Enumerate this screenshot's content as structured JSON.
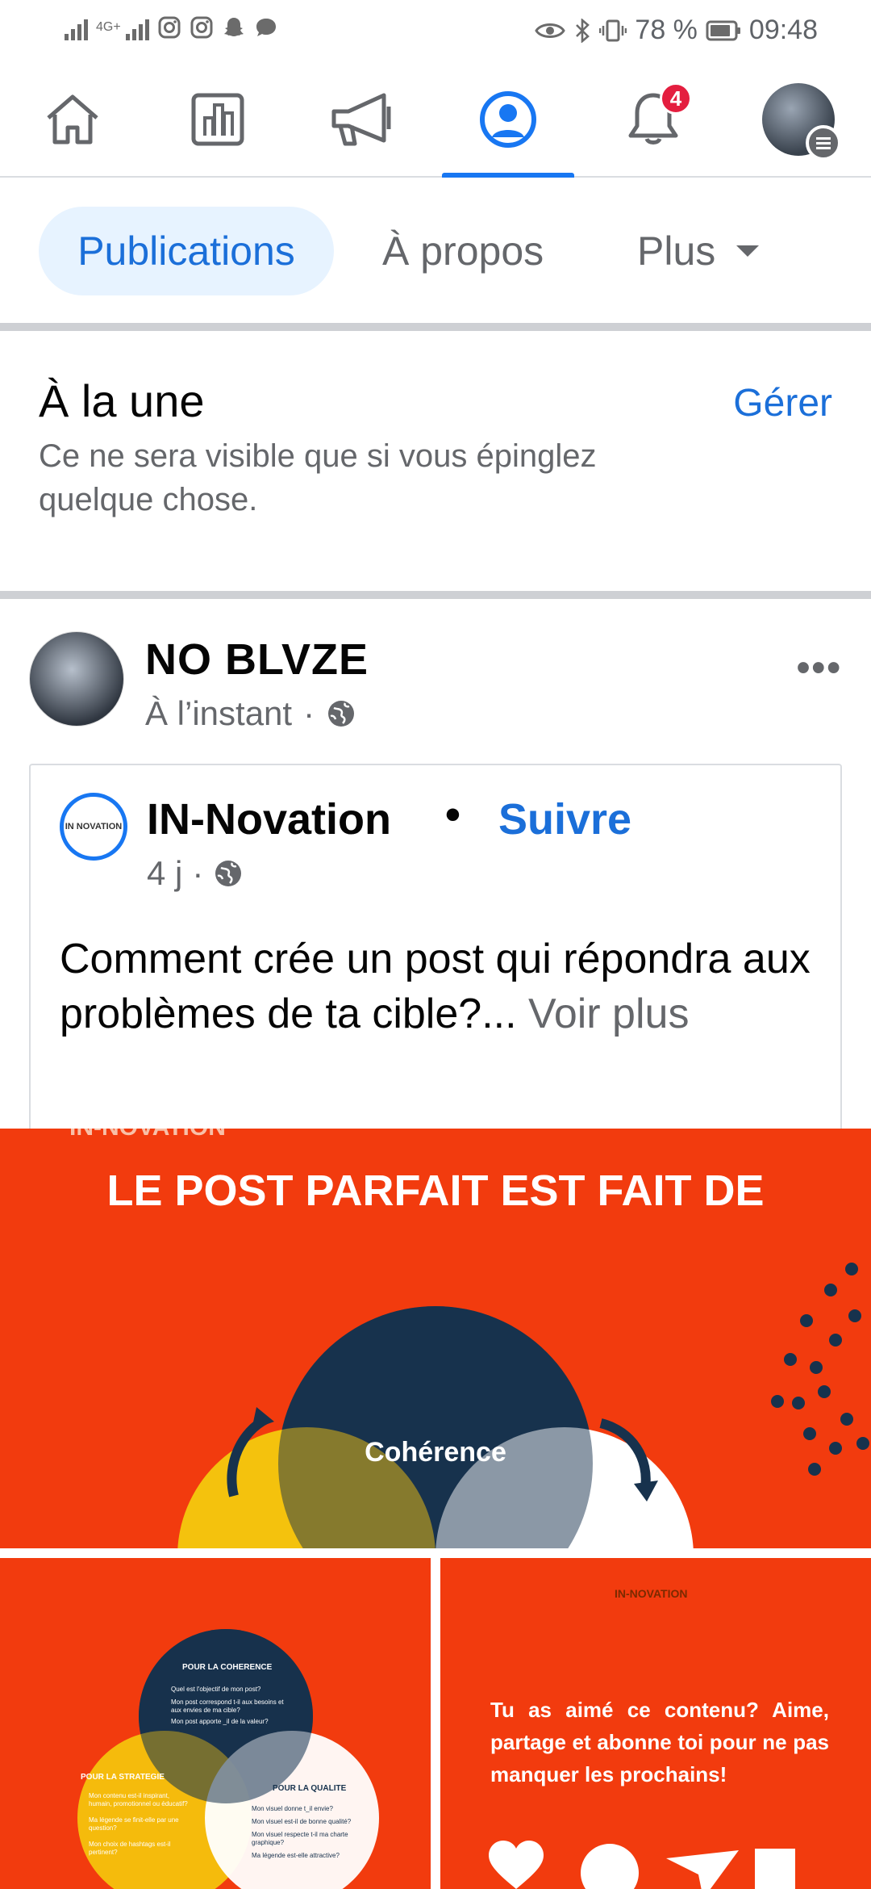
{
  "status_bar": {
    "network": "4G+",
    "battery": "78 %",
    "time": "09:48",
    "left_icons": [
      "signal-icon",
      "signal-icon",
      "instagram-icon",
      "instagram-icon",
      "snapchat-icon",
      "chat-icon"
    ],
    "right_icons": [
      "eye-icon",
      "bluetooth-icon",
      "vibrate-icon",
      "battery-icon"
    ]
  },
  "topnav": {
    "items": [
      "home-icon",
      "pages-icon",
      "ads-icon",
      "profile-icon",
      "bell-icon",
      "account-avatar"
    ],
    "active": "profile-icon",
    "notification_count": "4",
    "accent": "#1877f2"
  },
  "tabs": {
    "publications": "Publications",
    "about": "À propos",
    "more": "Plus"
  },
  "featured": {
    "title": "À la une",
    "manage": "Gérer",
    "subtitle": "Ce ne sera visible que si vous épinglez quelque chose."
  },
  "post": {
    "author": "NO BLVZE",
    "time": "À l’instant",
    "separator": "·",
    "more": "•••",
    "shared": {
      "page_name": "IN-Novation",
      "dot": "•",
      "follow": "Suivre",
      "time": "4 j",
      "separator": "·",
      "logo_text": "IN NOVATION",
      "text": "Comment crée un post qui répondra aux problèmes de ta cible?...",
      "see_more": "Voir plus"
    },
    "image_main": {
      "logo": "IN-NOVATION",
      "title": "LE POST PARFAIT EST FAIT DE",
      "center_label": "Cohérence"
    },
    "image_left": {
      "coherence_title": "POUR LA COHERENCE",
      "coherence_items": [
        "Quel est l'objectif de mon post?",
        "Mon post correspond t-il aux besoins et aux envies de ma cible?",
        "Mon post apporte _il de la valeur?"
      ],
      "strategy_title": "POUR LA STRATEGIE",
      "strategy_items": [
        "Mon contenu est-il inspirant, humain, promotionnel ou éducatif?",
        "Ma légende se finit-elle par une question?",
        "Mon choix de hashtags est-il pertinent?"
      ],
      "quality_title": "POUR LA QUALITE",
      "quality_items": [
        "Mon visuel donne t_il envie?",
        "Mon visuel est-il de bonne qualité?",
        "Mon visuel respecte t-il ma charte graphique?",
        "Ma légende est-elle attractive?"
      ]
    },
    "image_right": {
      "logo": "IN-NOVATION",
      "cta": "Tu as aimé ce contenu? Aime, partage et abonne toi pour ne pas manquer les prochains!"
    },
    "image_bg": "#f23b0e"
  }
}
